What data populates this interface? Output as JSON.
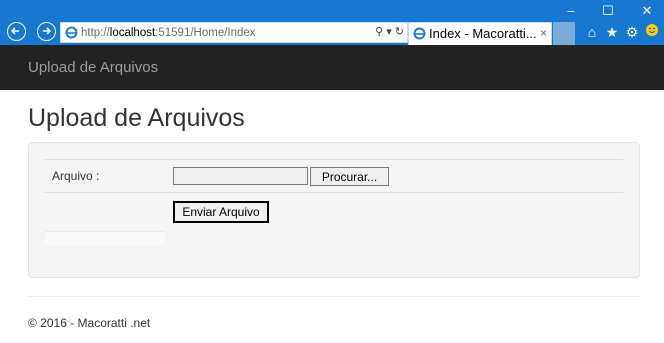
{
  "browser": {
    "url_prefix": "http://",
    "url_host": "localhost",
    "url_rest": ":51591/Home/Index",
    "address_tools": "⚲ ▾ ↻",
    "tab_title": "Index - Macoratti...",
    "tab_close": "×",
    "window_controls": {
      "minimize": "–",
      "maximize": "☐",
      "close": "✕"
    },
    "toolbar_icons": [
      "home-icon",
      "favorites-star-icon",
      "settings-gear-icon",
      "smiley-feedback-icon"
    ]
  },
  "navbar": {
    "brand": "Upload de Arquivos"
  },
  "page": {
    "title": "Upload de Arquivos",
    "form": {
      "file_label": "Arquivo :",
      "browse_label": "Procurar...",
      "submit_label": "Enviar Arquivo"
    }
  },
  "footer": {
    "text": "© 2016 - Macoratti .net"
  }
}
